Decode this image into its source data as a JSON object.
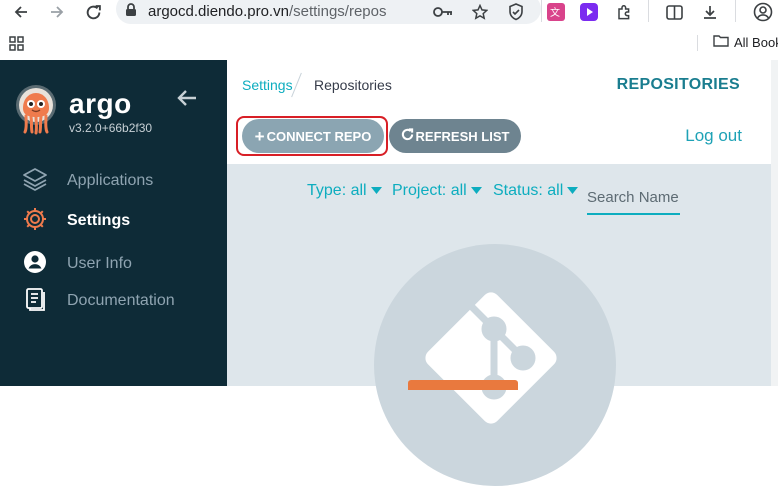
{
  "browser": {
    "url_host": "argocd.diendo.pro.vn",
    "url_path": "/settings/repos",
    "bookmarks_label": "All Book"
  },
  "sidebar": {
    "brand": "argo",
    "version": "v3.2.0+66b2f30",
    "items": [
      {
        "label": "Applications",
        "icon": "layers-icon",
        "active": false
      },
      {
        "label": "Settings",
        "icon": "gear-icon",
        "active": true
      },
      {
        "label": "User Info",
        "icon": "user-icon",
        "active": false
      },
      {
        "label": "Documentation",
        "icon": "document-icon",
        "active": false
      }
    ]
  },
  "header": {
    "breadcrumb": [
      "Settings",
      "Repositories"
    ],
    "title": "REPOSITORIES",
    "logout_label": "Log out"
  },
  "toolbar": {
    "connect_label": "CONNECT REPO",
    "refresh_label": "REFRESH LIST"
  },
  "filters": {
    "type_label": "Type: all",
    "project_label": "Project: all",
    "status_label": "Status: all",
    "search_placeholder": "Search Name"
  },
  "colors": {
    "sidebar_bg": "#0e2b37",
    "accent": "#0dadbf",
    "content_bg": "#dee6eb",
    "highlight": "#d81f26"
  }
}
